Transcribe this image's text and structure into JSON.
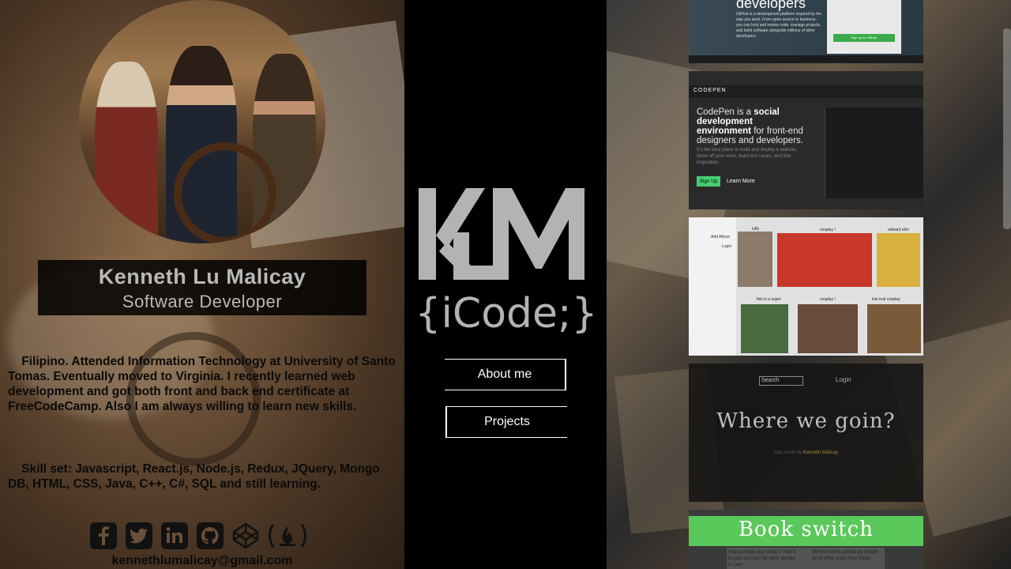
{
  "profile": {
    "name": "Kenneth Lu Malicay",
    "title": "Software Developer",
    "bio": "Filipino. Attended Information Technology at University of Santo Tomas. Eventually moved to Virginia. I recently learned web development and got both front and back end certificate at FreeCodeCamp. Also I am always willing to learn new skills.",
    "skills": "Skill set: Javascript, React.js, Node.js, Redux, JQuery, Mongo DB, HTML, CSS, Java, C++, C#, SQL and still learning.",
    "email": "kennethlumalicay@gmail.com",
    "social_icons": [
      "facebook-icon",
      "twitter-icon",
      "linkedin-icon",
      "github-icon",
      "codepen-icon",
      "freecodecamp-icon"
    ]
  },
  "logo": {
    "monogram": "KLM",
    "tagline": "{iCode;}"
  },
  "nav": {
    "about_label": "About me",
    "projects_label": "Projects"
  },
  "projects": {
    "github": {
      "heading": "developers",
      "body": "GitHub is a development platform inspired by the way you work. From open source to business, you can host and review code, manage projects, and build software alongside millions of other developers.",
      "button": "Sign up for GitHub"
    },
    "codepen": {
      "brand": "CODEPEN",
      "headline_pre": "CodePen is a ",
      "headline_bold": "social development environment",
      "headline_post": " for front-end designers and developers.",
      "sub": "It's the best place to build and deploy a website, show off your work, build test cases, and find inspiration.",
      "signup": "Sign Up",
      "learn": "Learn More"
    },
    "gallery": {
      "sidebar_items": [
        "Add Album",
        "Login"
      ],
      "captions": [
        "luffy",
        "cosplay !",
        "edward elric",
        "this is a super",
        "cosplay !",
        "low real cosplay"
      ]
    },
    "nightlife": {
      "search_placeholder": "Search",
      "login": "Login",
      "title": "Where we goin?",
      "by_pre": "App made by ",
      "by_name": "Kenneth Malicay"
    },
    "bookswitch": {
      "title": "Book switch",
      "col1": "Wanna trade your books? Add it to your account for other people to see!",
      "col2": "Borrow books posted by people all of other users then trade!"
    }
  },
  "colors": {
    "panel_bg": "#000000",
    "name_text": "#b9b9b9",
    "codepen_green": "#47cf73",
    "github_green": "#3cab4a"
  }
}
